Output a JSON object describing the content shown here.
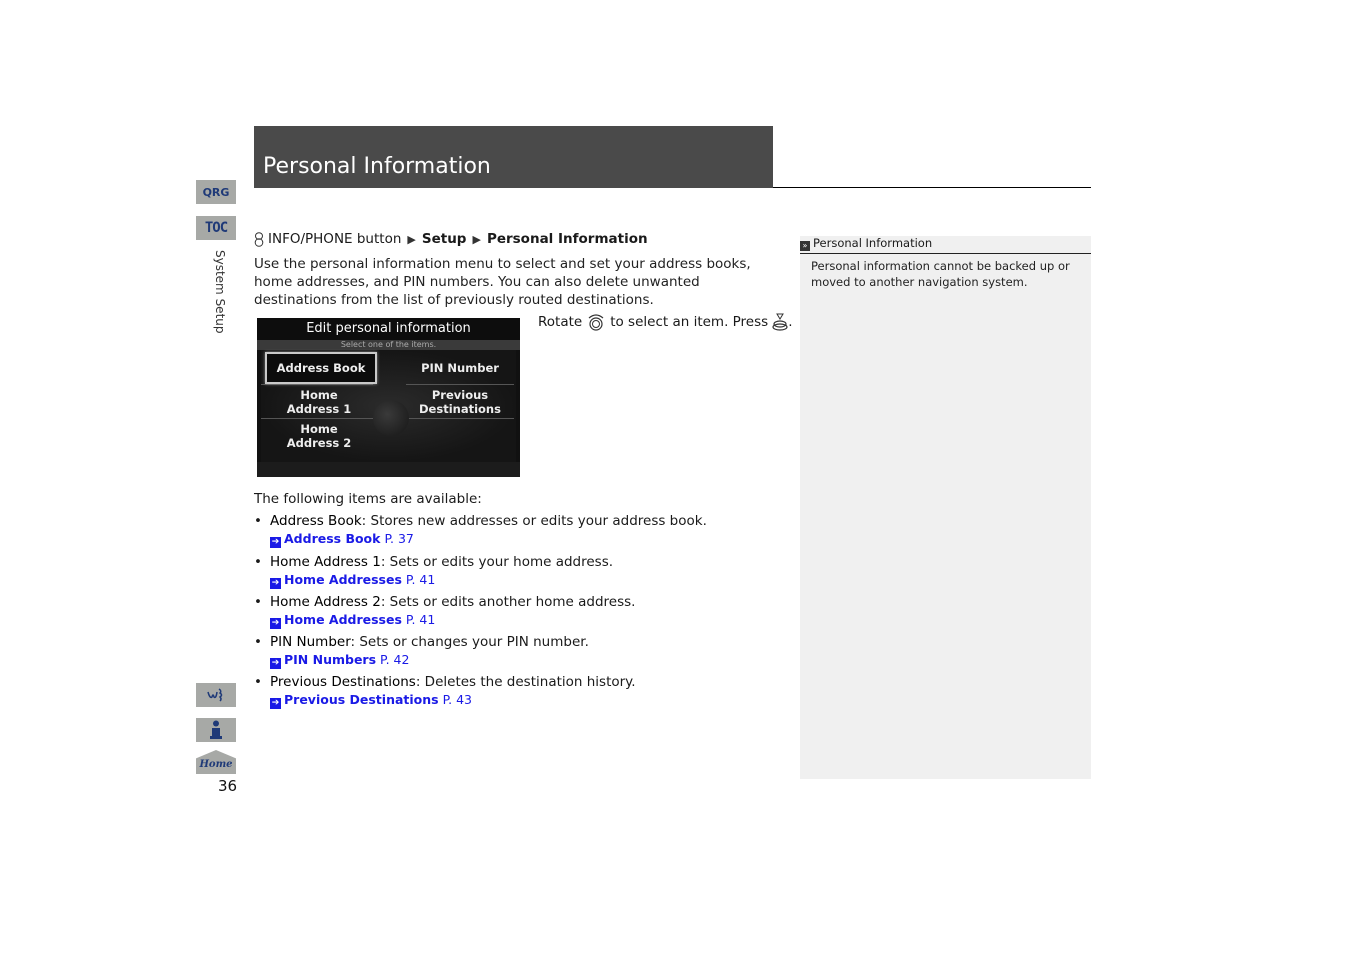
{
  "side_nav": {
    "qrg_label": "QRG",
    "toc_label": "TOC",
    "section_label": "System Setup",
    "voice_icon": "voice-command-icon",
    "info_icon": "info-icon",
    "home_label": "Home",
    "page_number": "36"
  },
  "header": {
    "title": "Personal Information"
  },
  "breadcrumb": {
    "icon": "info-phone-button-icon",
    "items": [
      "INFO/PHONE button",
      "Setup",
      "Personal Information"
    ],
    "separator": "▶"
  },
  "intro": "Use the personal information menu to select and set your address books, home addresses, and PIN numbers. You can also delete unwanted destinations from the list of previously routed destinations.",
  "screen": {
    "title": "Edit personal information",
    "subtitle": "Select one of the items.",
    "buttons": [
      {
        "label": "Address Book",
        "selected": true
      },
      {
        "label": "PIN Number",
        "selected": false
      },
      {
        "label": "Home\nAddress 1",
        "selected": false
      },
      {
        "label": "Previous\nDestinations",
        "selected": false
      },
      {
        "label": "Home\nAddress 2",
        "selected": false
      }
    ]
  },
  "instruction": {
    "part1": "Rotate",
    "rotate_icon": "interface-dial-rotate-icon",
    "part2": "to select an item. Press",
    "press_icon": "interface-dial-press-icon",
    "part3": "."
  },
  "available_label": "The following items are available:",
  "items": [
    {
      "name": "Address Book",
      "desc": ": Stores new addresses or edits your address book.",
      "ref_title": "Address Book",
      "ref_page": " P. 37"
    },
    {
      "name": "Home Address 1",
      "desc": ": Sets or edits your home address.",
      "ref_title": "Home Addresses",
      "ref_page": " P. 41"
    },
    {
      "name": "Home Address 2",
      "desc": ": Sets or edits another home address.",
      "ref_title": "Home Addresses",
      "ref_page": " P. 41"
    },
    {
      "name": "PIN Number",
      "desc": ": Sets or changes your PIN number.",
      "ref_title": "PIN Numbers",
      "ref_page": " P. 42"
    },
    {
      "name": "Previous Destinations",
      "desc": ": Deletes the destination history.",
      "ref_title": "Previous Destinations",
      "ref_page": " P. 43"
    }
  ],
  "note": {
    "marker": "»",
    "title": "Personal Information",
    "body": "Personal information cannot be backed up or moved to another navigation system."
  },
  "colors": {
    "title_bar": "#4a4a4a",
    "link": "#1a1ae6",
    "side_tab": "#a7a9a6",
    "side_tab_text": "#1f3a78",
    "note_bg": "#f0f0f0"
  }
}
